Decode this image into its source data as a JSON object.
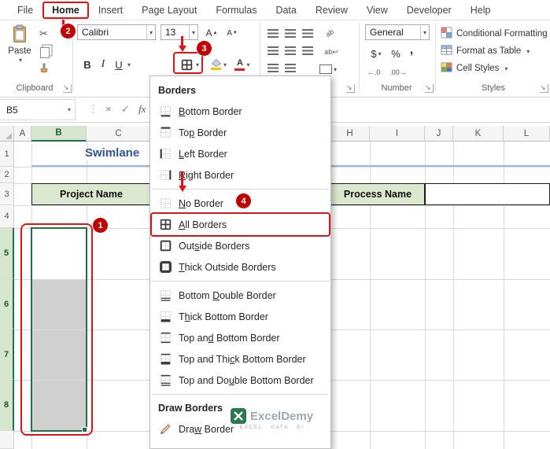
{
  "window": {
    "tabs": [
      {
        "label": "File"
      },
      {
        "label": "Home",
        "selected": true
      },
      {
        "label": "Insert"
      },
      {
        "label": "Page Layout"
      },
      {
        "label": "Formulas"
      },
      {
        "label": "Data"
      },
      {
        "label": "Review"
      },
      {
        "label": "View"
      },
      {
        "label": "Developer"
      },
      {
        "label": "Help"
      }
    ]
  },
  "ribbon": {
    "clipboard": {
      "group_label": "Clipboard",
      "paste_label": "Paste"
    },
    "font": {
      "name": "Calibri",
      "size": "13",
      "bold": "B",
      "italic": "I",
      "underline": "U"
    },
    "number": {
      "group_label": "Number",
      "format": "General",
      "currency": "$",
      "percent": "%",
      "comma": ",",
      "increase_decimal": "←.0",
      "decrease_decimal": ".00→"
    },
    "styles": {
      "group_label": "Styles",
      "conditional_formatting": "Conditional Formatting",
      "format_as_table": "Format as Table",
      "cell_styles": "Cell Styles"
    }
  },
  "formula_bar": {
    "name_box": "B5",
    "cancel": "×",
    "enter": "✓",
    "fx": "fx"
  },
  "sheet": {
    "columns_left": [
      "A",
      "B",
      "C"
    ],
    "columns_right": [
      "H",
      "I",
      "J",
      "K",
      "L"
    ],
    "rows": [
      "1",
      "2",
      "3",
      "4",
      "5",
      "6",
      "7",
      "8"
    ],
    "title": "Swimlane",
    "project_header": "Project Name",
    "process_header": "Process Name"
  },
  "menu": {
    "sections": [
      {
        "type": "header",
        "label": "Borders"
      },
      {
        "type": "item",
        "label": "Bottom Border",
        "accel": 0,
        "icon": "bottom-border-icon"
      },
      {
        "type": "item",
        "label": "Top Border",
        "accel": 2,
        "icon": "top-border-icon"
      },
      {
        "type": "item",
        "label": "Left Border",
        "accel": 0,
        "icon": "left-border-icon"
      },
      {
        "type": "item",
        "label": "Right Border",
        "accel": 0,
        "icon": "right-border-icon"
      },
      {
        "type": "separator"
      },
      {
        "type": "item",
        "label": "No Border",
        "accel": 0,
        "icon": "no-border-icon"
      },
      {
        "type": "item",
        "label": "All Borders",
        "accel": 0,
        "icon": "all-borders-icon",
        "highlighted": true
      },
      {
        "type": "item",
        "label": "Outside Borders",
        "accel": 3,
        "icon": "outside-borders-icon"
      },
      {
        "type": "item",
        "label": "Thick Outside Borders",
        "accel": 0,
        "icon": "thick-outside-borders-icon"
      },
      {
        "type": "separator"
      },
      {
        "type": "item",
        "label": "Bottom Double Border",
        "accel": 7,
        "icon": "bottom-double-border-icon"
      },
      {
        "type": "item",
        "label": "Thick Bottom Border",
        "accel": 1,
        "icon": "thick-bottom-border-icon"
      },
      {
        "type": "item",
        "label": "Top and Bottom Border",
        "accel": 6,
        "icon": "top-and-bottom-border-icon"
      },
      {
        "type": "item",
        "label": "Top and Thick Bottom Border",
        "accel": 11,
        "icon": "top-and-thick-bottom-border-icon"
      },
      {
        "type": "item",
        "label": "Top and Double Bottom Border",
        "accel": 10,
        "icon": "top-and-double-bottom-border-icon"
      },
      {
        "type": "separator"
      },
      {
        "type": "header",
        "label": "Draw Borders"
      },
      {
        "type": "item",
        "label": "Draw Border",
        "accel": 3,
        "icon": "draw-border-icon"
      }
    ],
    "watermark": {
      "brand": "ExcelDemy",
      "tagline": "EXCEL · DATA · BI"
    }
  },
  "annotations": {
    "step1": "1",
    "step2": "2",
    "step3": "3",
    "step4": "4"
  },
  "colors": {
    "accent_green": "#217346",
    "header_fill": "#DCE7CF",
    "lane_gray": "#D0D0D0",
    "annotation_red": "#DE1414",
    "badge_red": "#C00000",
    "title_blue": "#2F5597"
  }
}
